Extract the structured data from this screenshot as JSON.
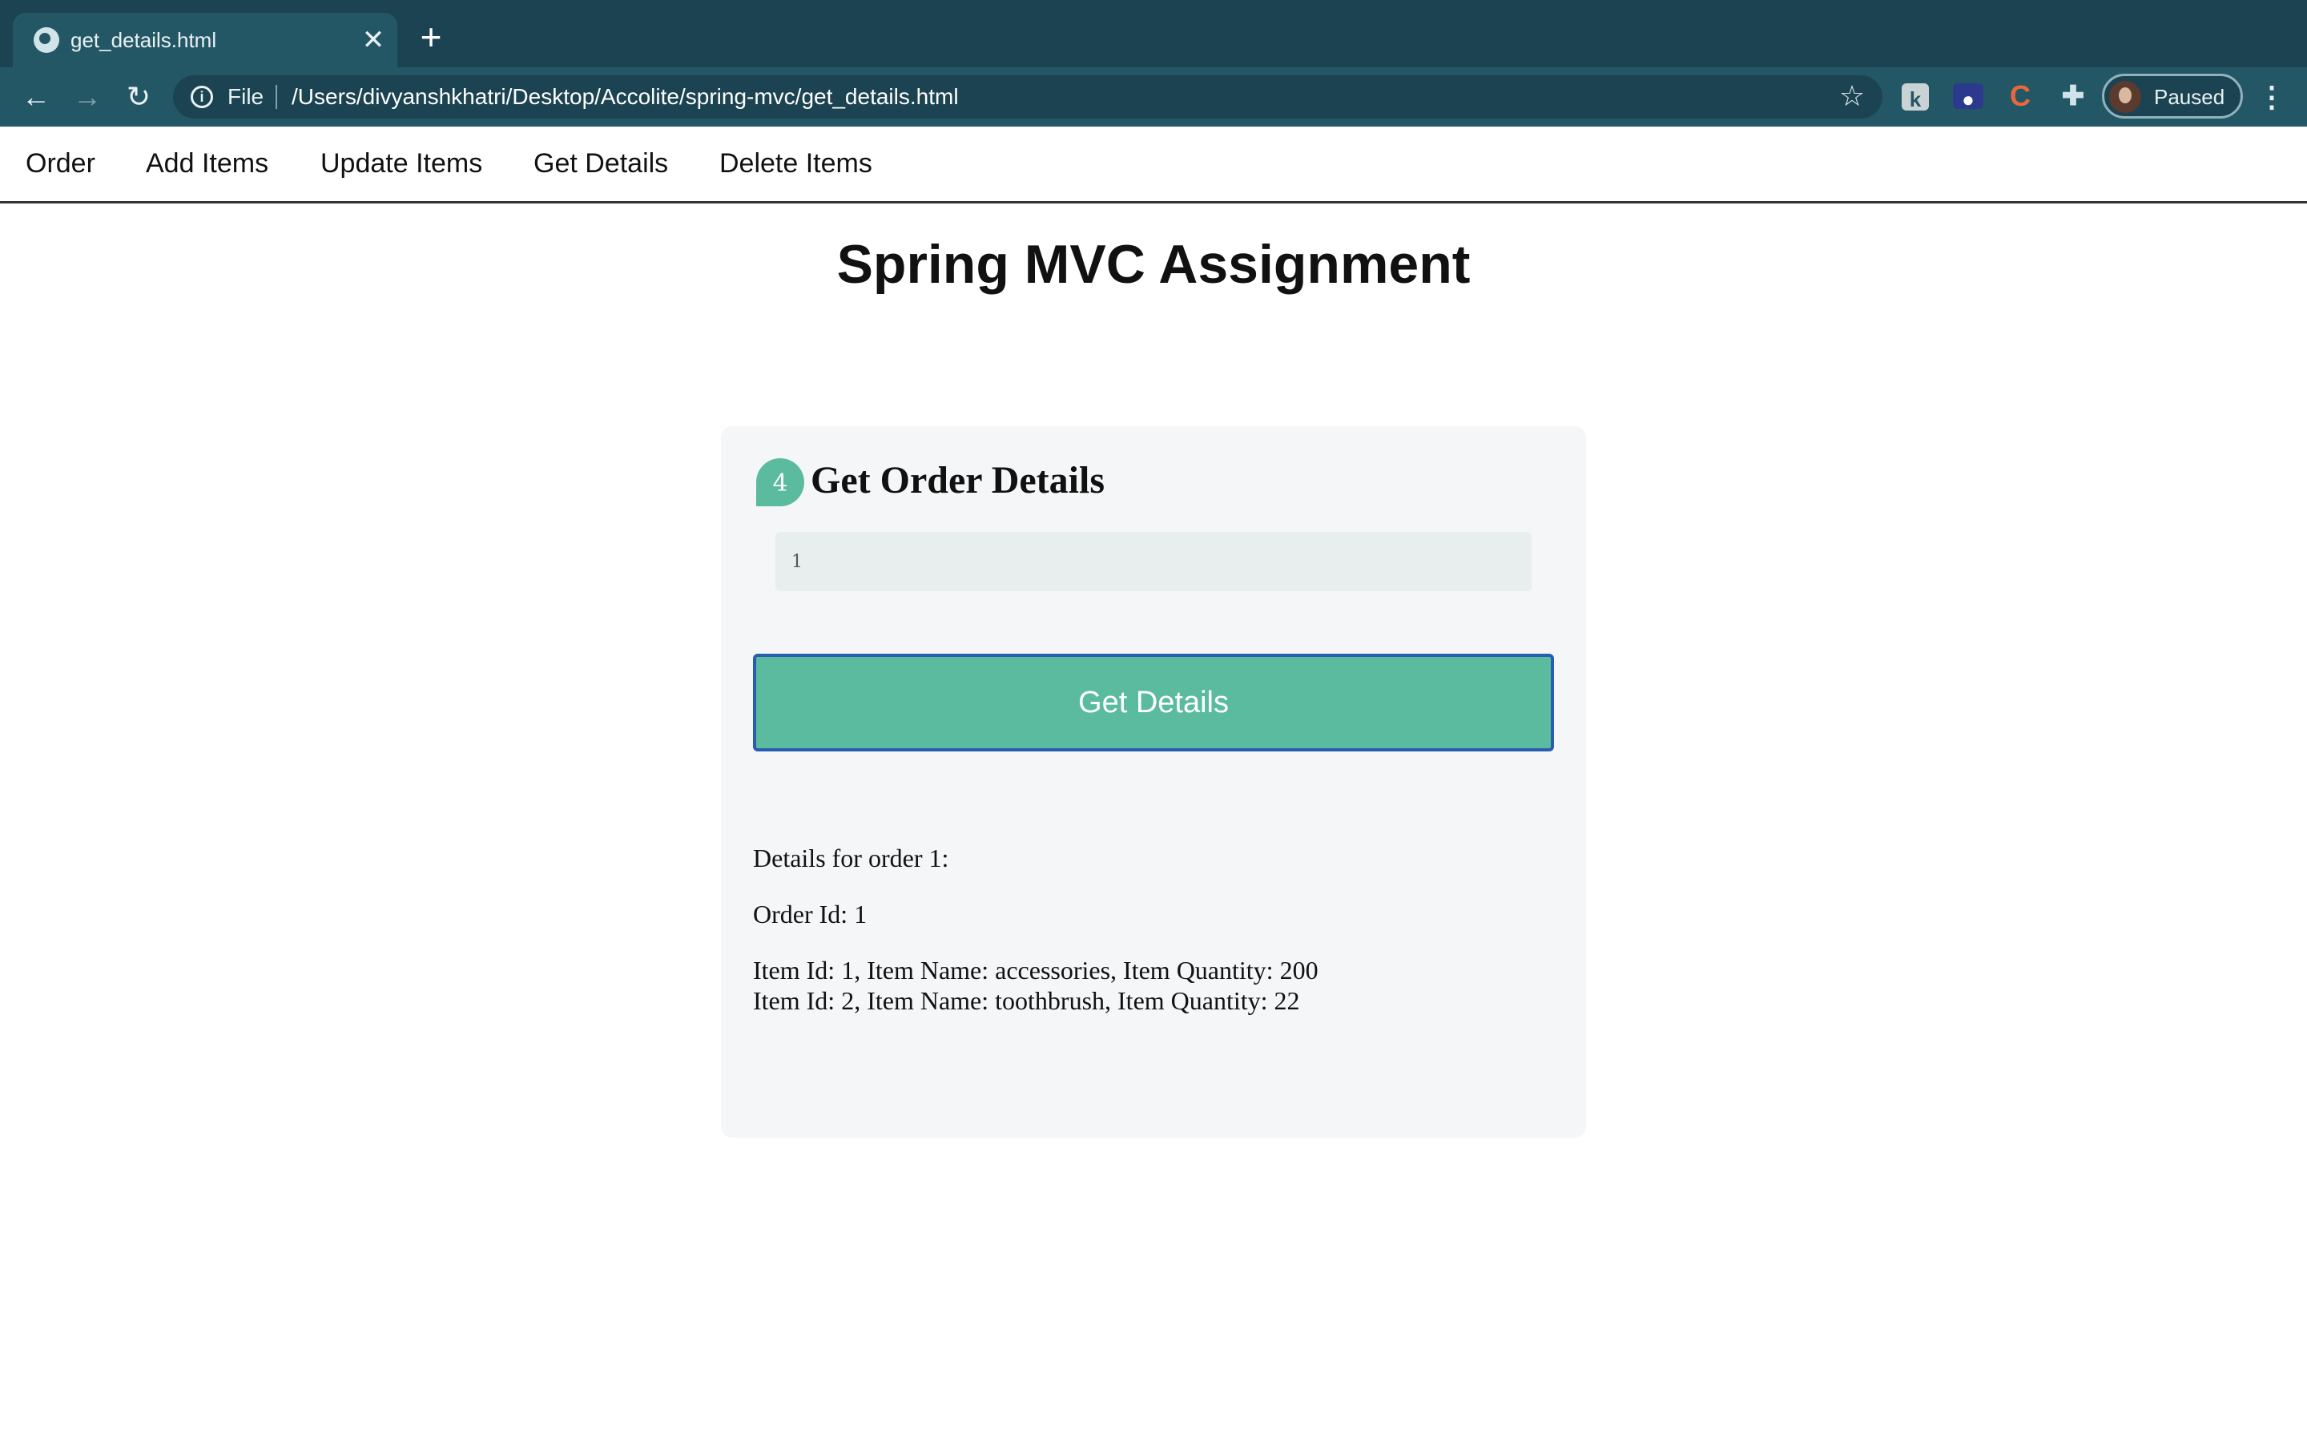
{
  "browser": {
    "tab_title": "get_details.html",
    "tab_close": "✕",
    "new_tab": "+",
    "back": "←",
    "forward": "→",
    "reload": "↻",
    "scheme_label": "File",
    "url": "/Users/divyanshkhatri/Desktop/Accolite/spring-mvc/get_details.html",
    "bookmark": "☆",
    "profile_status": "Paused",
    "menu": "⋮",
    "extensions": [
      "k-extension-icon",
      "screen-recorder-icon",
      "c-extension-icon",
      "puzzle-icon"
    ]
  },
  "navbar": {
    "items": [
      "Order",
      "Add Items",
      "Update Items",
      "Get Details",
      "Delete Items"
    ]
  },
  "page": {
    "title": "Spring MVC Assignment"
  },
  "card": {
    "step_number": "4",
    "title": "Get Order Details",
    "input_value": "1",
    "button_label": "Get Details",
    "details_heading": "Details for order 1:",
    "order_id_line": "Order Id: 1",
    "items": [
      "Item Id: 1, Item Name: accessories, Item Quantity: 200",
      "Item Id: 2, Item Name: toothbrush, Item Quantity: 22"
    ]
  },
  "colors": {
    "chrome_dark": "#1c4351",
    "chrome_tab": "#245766",
    "accent_green": "#5bbb9e",
    "button_border": "#2a5db0",
    "card_bg": "#f4f6f7"
  }
}
